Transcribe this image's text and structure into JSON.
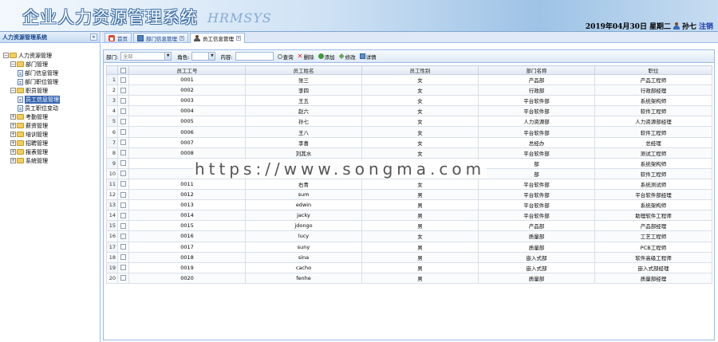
{
  "header": {
    "title": "企业人力资源管理系统",
    "subtitle": "HRMSYS",
    "date": "2019年04月30日",
    "weekday": "星期二",
    "user_name": "孙七",
    "logout_label": "注销"
  },
  "sidebar": {
    "title": "人力资源管理系统",
    "collapse_label": "«",
    "tree": [
      {
        "label": "人力资源管理",
        "level": 0,
        "type": "folder",
        "toggle": "−"
      },
      {
        "label": "部门管理",
        "level": 1,
        "type": "folder",
        "toggle": "−"
      },
      {
        "label": "部门信息管理",
        "level": 2,
        "type": "page"
      },
      {
        "label": "部门职位管理",
        "level": 2,
        "type": "page"
      },
      {
        "label": "职员管理",
        "level": 1,
        "type": "folder",
        "toggle": "−"
      },
      {
        "label": "员工信息管理",
        "level": 2,
        "type": "page",
        "selected": true
      },
      {
        "label": "员工职位变动",
        "level": 2,
        "type": "page"
      },
      {
        "label": "考勤管理",
        "level": 1,
        "type": "folder",
        "toggle": "+"
      },
      {
        "label": "薪资管理",
        "level": 1,
        "type": "folder",
        "toggle": "+"
      },
      {
        "label": "培训管理",
        "level": 1,
        "type": "folder",
        "toggle": "+"
      },
      {
        "label": "招聘管理",
        "level": 1,
        "type": "folder",
        "toggle": "+"
      },
      {
        "label": "报表管理",
        "level": 1,
        "type": "folder",
        "toggle": "+"
      },
      {
        "label": "系统管理",
        "level": 1,
        "type": "folder",
        "toggle": "+"
      }
    ]
  },
  "tabs": [
    {
      "label": "首页",
      "icon": "home-icon",
      "closable": false
    },
    {
      "label": "部门信息管理",
      "icon": "list-icon",
      "closable": true
    },
    {
      "label": "员工信息管理",
      "icon": "employee-icon",
      "closable": true,
      "active": true
    }
  ],
  "toolbar": {
    "dept_label": "部门:",
    "dept_value": "全部",
    "role_label": "角色:",
    "role_value": "",
    "content_label": "内容:",
    "content_value": "",
    "search_label": "查询",
    "delete_label": "删除",
    "add_label": "添加",
    "edit_label": "修改",
    "detail_label": "详情"
  },
  "grid": {
    "columns": [
      "员工工号",
      "员工姓名",
      "员工性别",
      "部门名称",
      "职位"
    ],
    "rows": [
      [
        "0001",
        "张三",
        "女",
        "产品部",
        "产品工程师"
      ],
      [
        "0002",
        "李四",
        "女",
        "行政部",
        "行政部经理"
      ],
      [
        "0003",
        "王五",
        "女",
        "平台软件部",
        "系统架构师"
      ],
      [
        "0004",
        "赵六",
        "女",
        "平台软件部",
        "软件工程师"
      ],
      [
        "0005",
        "孙七",
        "女",
        "人力资源部",
        "人力资源部经理"
      ],
      [
        "0006",
        "王八",
        "女",
        "平台软件部",
        "软件工程师"
      ],
      [
        "0007",
        "李喜",
        "女",
        "总经办",
        "总经理"
      ],
      [
        "0008",
        "刘其水",
        "女",
        "平台软件部",
        "测试工程师"
      ],
      [
        "",
        "",
        "",
        "部",
        "系统架构师"
      ],
      [
        "",
        "",
        "",
        "部",
        "软件工程师"
      ],
      [
        "0011",
        "右青",
        "女",
        "平台软件部",
        "系统测试师"
      ],
      [
        "0012",
        "sum",
        "男",
        "平台软件部",
        "平台软件部经理"
      ],
      [
        "0013",
        "edwin",
        "男",
        "平台软件部",
        "系统架构师"
      ],
      [
        "0014",
        "jacky",
        "男",
        "平台软件部",
        "助理软件工程师"
      ],
      [
        "0015",
        "jdongo",
        "男",
        "产品部",
        "产品部经理"
      ],
      [
        "0016",
        "lucy",
        "女",
        "质量部",
        "工艺工程师"
      ],
      [
        "0017",
        "suny",
        "男",
        "质量部",
        "PCB工程师"
      ],
      [
        "0018",
        "sina",
        "男",
        "嵌入式部",
        "软件高级工程师"
      ],
      [
        "0019",
        "cacho",
        "男",
        "嵌入式部",
        "嵌入式部经理"
      ],
      [
        "0020",
        "fenhe",
        "男",
        "质量部",
        "质量部经理"
      ]
    ]
  },
  "watermark": "https://www.songma.com"
}
